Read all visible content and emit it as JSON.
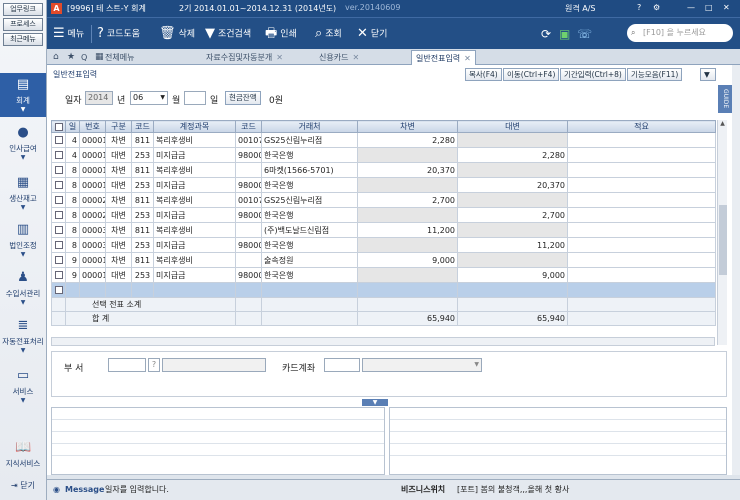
{
  "sidebar": {
    "top_buttons": [
      "업무링크",
      "프로세스",
      "최근메뉴"
    ],
    "items": [
      {
        "label": "회계",
        "icon": "ledger-icon"
      },
      {
        "label": "인사급여",
        "icon": "person-icon"
      },
      {
        "label": "생산재고",
        "icon": "boxes-icon"
      },
      {
        "label": "법인조정",
        "icon": "building-icon"
      },
      {
        "label": "수입서관리",
        "icon": "people-icon"
      },
      {
        "label": "자동전표처리",
        "icon": "database-icon"
      },
      {
        "label": "서비스",
        "icon": "monitor-icon"
      },
      {
        "label": "지식서비스",
        "icon": "book-icon"
      }
    ],
    "close_label": "닫기"
  },
  "titlebar": {
    "company": "[9996] 테 스트-Y 회계",
    "period": "2기 2014.01.01~2014.12.31 (2014년도)",
    "version": "ver.20140609",
    "right_text": "원격 A/S"
  },
  "toolbar": {
    "menu": "메뉴",
    "help": "코드도움",
    "delete": "삭제",
    "filter": "조건검색",
    "print": "인쇄",
    "lookup": "조회",
    "close": "닫기",
    "search_placeholder": "[F10] 을 누르세요"
  },
  "tabs": {
    "full_menu": "전체메뉴",
    "items": [
      "자료수집및자동분개",
      "신용카드",
      "일반전표입력"
    ]
  },
  "page": {
    "title": "일반전표입력",
    "guide_label": "GUIDE",
    "buttons": [
      "복사(F4)",
      "이동(Ctrl+F4)",
      "기간입력(Ctrl+8)",
      "기능모음(F11)"
    ]
  },
  "filter": {
    "label_date": "일자",
    "year": "2014",
    "year_suffix": "년",
    "month": "06",
    "month_suffix": "월",
    "day_suffix": "일",
    "cash_balance_label": "현금잔액",
    "cash_balance_value": "0원"
  },
  "grid": {
    "columns": [
      "",
      "일",
      "번호",
      "구분",
      "코드",
      "계정과목",
      "코드",
      "거래처",
      "차변",
      "대변",
      "적요"
    ],
    "rows": [
      {
        "day": "4",
        "no": "00001",
        "type": "차변",
        "code": "811",
        "account": "복리후생비",
        "ccode": "00107",
        "client": "GS25신림누리점",
        "debit": "2,280",
        "credit": ""
      },
      {
        "day": "4",
        "no": "00001",
        "type": "대변",
        "code": "253",
        "account": "미지급금",
        "ccode": "98000",
        "client": "한국은행",
        "debit": "",
        "credit": "2,280"
      },
      {
        "day": "8",
        "no": "00001",
        "type": "차변",
        "code": "811",
        "account": "복리후생비",
        "ccode": "",
        "client": "6마켓(1566-5701)",
        "debit": "20,370",
        "credit": ""
      },
      {
        "day": "8",
        "no": "00001",
        "type": "대변",
        "code": "253",
        "account": "미지급금",
        "ccode": "98000",
        "client": "한국은행",
        "debit": "",
        "credit": "20,370"
      },
      {
        "day": "8",
        "no": "00002",
        "type": "차변",
        "code": "811",
        "account": "복리후생비",
        "ccode": "00107",
        "client": "GS25신림누리점",
        "debit": "2,700",
        "credit": ""
      },
      {
        "day": "8",
        "no": "00002",
        "type": "대변",
        "code": "253",
        "account": "미지급금",
        "ccode": "98000",
        "client": "한국은행",
        "debit": "",
        "credit": "2,700"
      },
      {
        "day": "8",
        "no": "00003",
        "type": "차변",
        "code": "811",
        "account": "복리후생비",
        "ccode": "",
        "client": "(주)백도날드신림점",
        "debit": "11,200",
        "credit": ""
      },
      {
        "day": "8",
        "no": "00003",
        "type": "대변",
        "code": "253",
        "account": "미지급금",
        "ccode": "98000",
        "client": "한국은행",
        "debit": "",
        "credit": "11,200"
      },
      {
        "day": "9",
        "no": "00001",
        "type": "차변",
        "code": "811",
        "account": "복리후생비",
        "ccode": "",
        "client": "술속정원",
        "debit": "9,000",
        "credit": ""
      },
      {
        "day": "9",
        "no": "00001",
        "type": "대변",
        "code": "253",
        "account": "미지급금",
        "ccode": "98000",
        "client": "한국은행",
        "debit": "",
        "credit": "9,000"
      }
    ],
    "selected_subtotal_label": "선택 전표 소계",
    "total_label": "합        계",
    "total_debit": "65,940",
    "total_credit": "65,940"
  },
  "lower": {
    "dept_label": "부        서",
    "card_label": "카드계좌"
  },
  "statusbar": {
    "message_label": "Message",
    "message": "일자를 입력합니다.",
    "biz_switch": "비즈니스위치",
    "tip": "[포트] 봄의 불청객,,,올해 첫 황사"
  }
}
